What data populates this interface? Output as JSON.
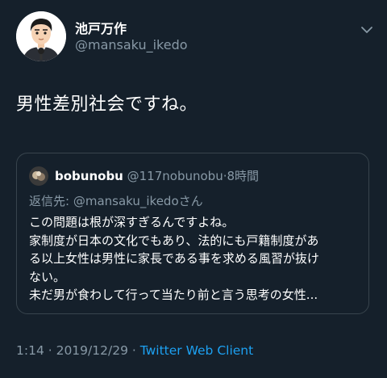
{
  "tweet": {
    "author_name": "池戸万作",
    "author_handle": "@mansaku_ikedo",
    "text": "男性差別社会ですね。",
    "quoted": {
      "name": "bobunobu",
      "handle": "@117nobunobu",
      "separator": "·",
      "time": "8時間",
      "reply_prefix": "返信先: ",
      "reply_mention": "@mansaku_ikedo",
      "reply_suffix": "さん",
      "lines": [
        "この問題は根が深すぎるんですよね。",
        "家制度が日本の文化でもあり、法的にも戸籍制度があ",
        "る以上女性は男性に家長である事を求める風習が抜け",
        "ない。",
        "未だ男が食わして行って当たり前と言う思考の女性..."
      ]
    },
    "footer": {
      "timestamp": "1:14 · 2019/12/29 · ",
      "client": "Twitter Web Client"
    }
  },
  "icons": {
    "menu": "chevron-down-icon"
  },
  "colors": {
    "background": "#15202b",
    "secondary_text": "#8899a6",
    "link": "#1da1f2",
    "border": "#38444d"
  }
}
